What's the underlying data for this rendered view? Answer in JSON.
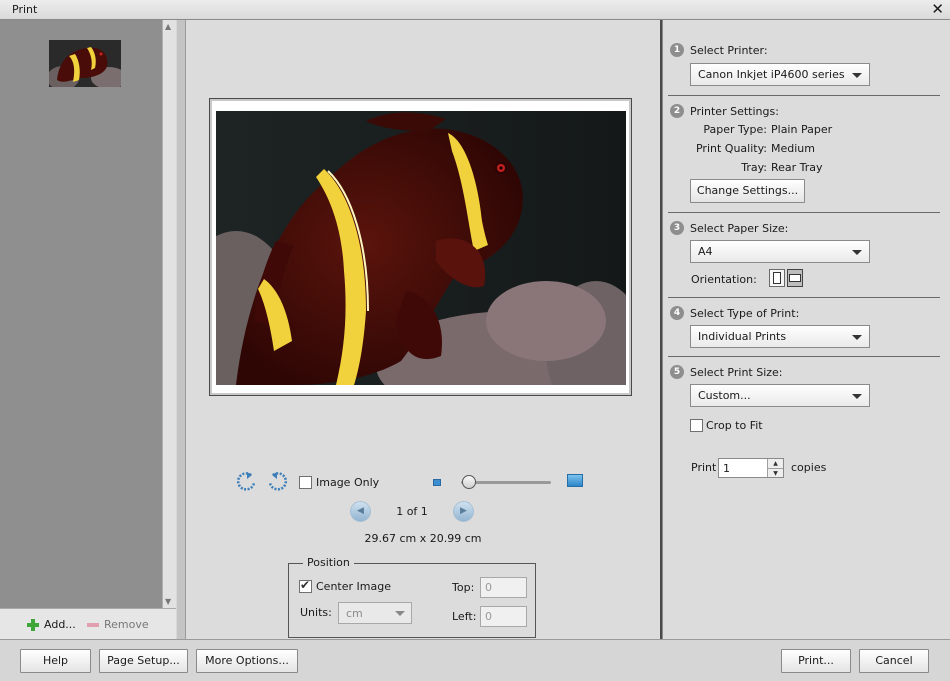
{
  "window": {
    "title": "Print"
  },
  "thumbnails": {
    "add_label": "Add...",
    "remove_label": "Remove"
  },
  "preview": {
    "image_only_label": "Image Only",
    "page_counter": "1 of 1",
    "dimensions": "29.67 cm x 20.99 cm",
    "zoom_level": 0.05
  },
  "position": {
    "legend": "Position",
    "center_image_label": "Center Image",
    "center_image_checked": true,
    "units_label": "Units:",
    "units_value": "cm",
    "top_label": "Top:",
    "top_value": "0",
    "left_label": "Left:",
    "left_value": "0"
  },
  "settings": {
    "step1": {
      "num": "1",
      "label": "Select Printer:",
      "value": "Canon Inkjet iP4600 series"
    },
    "step2": {
      "num": "2",
      "label": "Printer Settings:",
      "paper_type_label": "Paper Type:",
      "paper_type": "Plain Paper",
      "quality_label": "Print Quality:",
      "quality": "Medium",
      "tray_label": "Tray:",
      "tray": "Rear Tray",
      "change_button": "Change Settings..."
    },
    "step3": {
      "num": "3",
      "label": "Select Paper Size:",
      "value": "A4",
      "orientation_label": "Orientation:"
    },
    "step4": {
      "num": "4",
      "label": "Select Type of Print:",
      "value": "Individual Prints"
    },
    "step5": {
      "num": "5",
      "label": "Select Print Size:",
      "value": "Custom...",
      "crop_label": "Crop to Fit"
    },
    "copies": {
      "print_label": "Print",
      "value": "1",
      "copies_label": "copies"
    }
  },
  "footer": {
    "help": "Help",
    "page_setup": "Page Setup...",
    "more_options": "More Options...",
    "print": "Print...",
    "cancel": "Cancel"
  },
  "colors": {
    "fish_body": "#4a0c08",
    "fish_stripe": "#f2d23c",
    "accent": "#3b8fd0"
  }
}
